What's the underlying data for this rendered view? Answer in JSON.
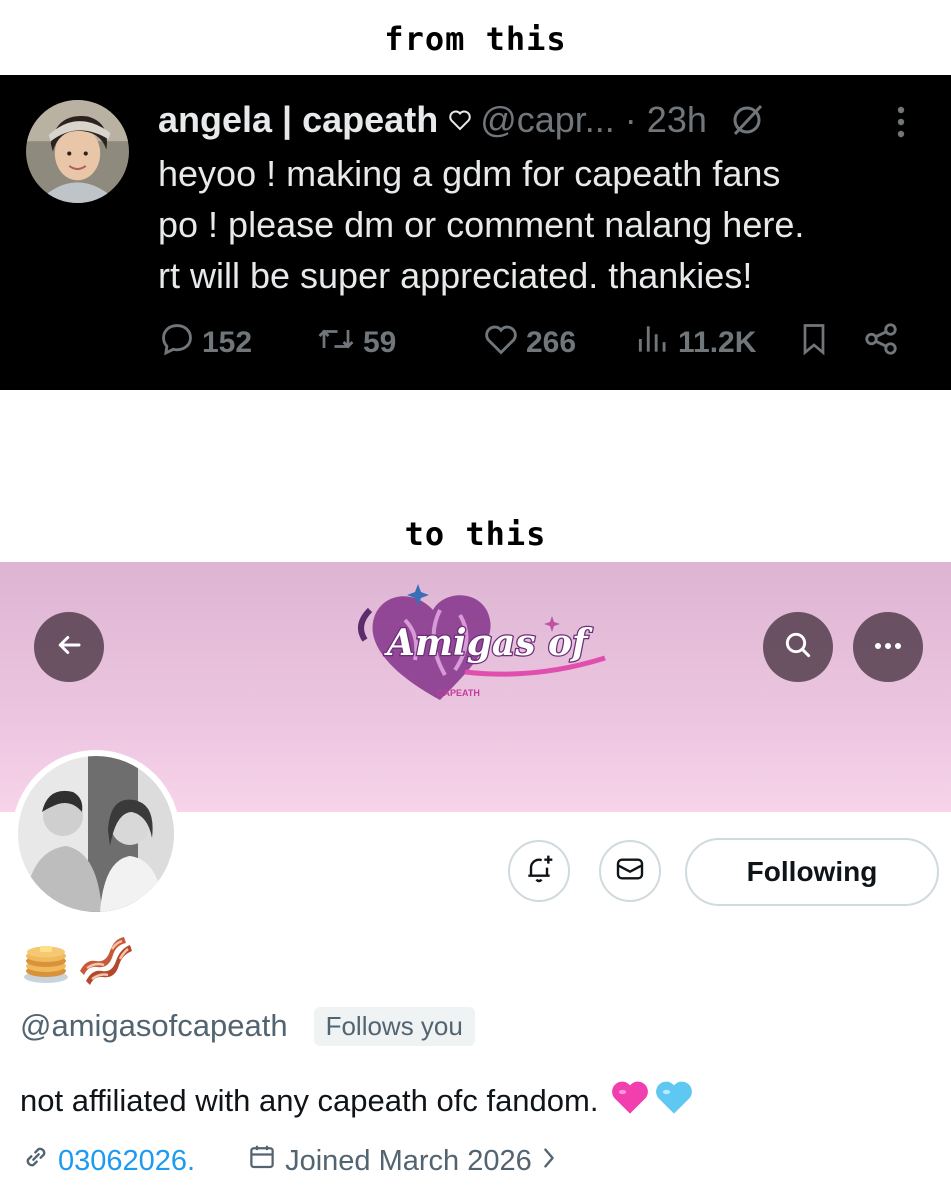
{
  "captions": {
    "top": "from this",
    "middle": "to this"
  },
  "tweet": {
    "display_name": "angela | capeath",
    "handle": "@capr...",
    "separator": "·",
    "time": "23h",
    "text_lines": [
      "heyoo ! making a gdm for capeath fans",
      "po ! please dm or comment nalang here.",
      "rt will be super appreciated. thankies!"
    ],
    "stats": {
      "replies": "152",
      "retweets": "59",
      "likes": "266",
      "views": "11.2K"
    },
    "colors": {
      "background": "#000000",
      "text": "#e7e9ea",
      "muted": "#71767b"
    }
  },
  "profile": {
    "banner_logo_text": "Amigas of",
    "banner_logo_subtext": "CAPEATH",
    "handle": "@amigasofcapeath",
    "follows_you_badge": "Follows you",
    "bio": "not affiliated with any capeath ofc fandom.",
    "bio_emojis": [
      "pink-heart",
      "light-blue-heart"
    ],
    "name_emojis": [
      "pancakes",
      "bacon"
    ],
    "website": "03062026.",
    "joined": "Joined March 2026",
    "following_button": "Following",
    "colors": {
      "banner": "#eec8e2",
      "link": "#1d9bf0",
      "muted": "#536471"
    }
  }
}
